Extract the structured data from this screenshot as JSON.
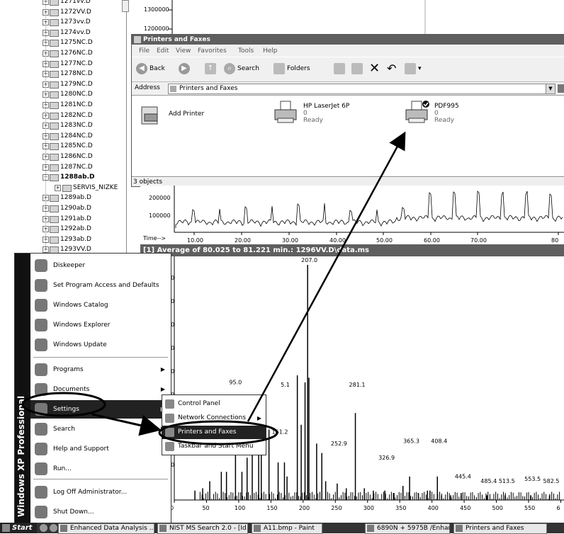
{
  "tree": {
    "items": [
      {
        "label": "1271vv.D"
      },
      {
        "label": "1272VV.D"
      },
      {
        "label": "1273vv.D"
      },
      {
        "label": "1274vv.D"
      },
      {
        "label": "1275NC.D"
      },
      {
        "label": "1276NC.D"
      },
      {
        "label": "1277NC.D"
      },
      {
        "label": "1278NC.D"
      },
      {
        "label": "1279NC.D"
      },
      {
        "label": "1280NC.D"
      },
      {
        "label": "1281NC.D"
      },
      {
        "label": "1282NC.D"
      },
      {
        "label": "1283NC.D"
      },
      {
        "label": "1284NC.D"
      },
      {
        "label": "1285NC.D"
      },
      {
        "label": "1286NC.D"
      },
      {
        "label": "1287NC.D"
      },
      {
        "label": "1288ab.D"
      },
      {
        "label": "SERVIS_NIZKE"
      },
      {
        "label": "1289ab.D"
      },
      {
        "label": "1290ab.D"
      },
      {
        "label": "1291ab.D"
      },
      {
        "label": "1292ab.D"
      },
      {
        "label": "1293ab.D"
      },
      {
        "label": "1293VV.D"
      }
    ]
  },
  "top_chart": {
    "ticks": [
      "1300000",
      "1200000"
    ]
  },
  "printers_window": {
    "title": "Printers and Faxes",
    "menu": [
      "File",
      "Edit",
      "View",
      "Favorites",
      "Tools",
      "Help"
    ],
    "toolbar": {
      "back": "Back",
      "search": "Search",
      "folders": "Folders"
    },
    "address_label": "Address",
    "address_value": "Printers and Faxes",
    "printers": [
      {
        "name": "Add Printer",
        "count": "",
        "status": ""
      },
      {
        "name": "HP LaserJet 6P",
        "count": "0",
        "status": "Ready"
      },
      {
        "name": "PDF995",
        "count": "0",
        "status": "Ready"
      }
    ],
    "status": "3 objects"
  },
  "mid_chart": {
    "ticks_y": [
      "200000",
      "100000"
    ],
    "time_label": "Time-->",
    "ticks_x": [
      "10.00",
      "20.00",
      "30.00",
      "40.00",
      "50.00",
      "60.00",
      "70.00",
      "80"
    ]
  },
  "spectrum": {
    "title": "[1] Average of 80.025 to 81.221 min.: 1296VV.D\\data.ms",
    "abundance_label": "nce",
    "y_ticks": [
      "000",
      "000",
      "000",
      "000",
      "000",
      "000",
      "000",
      "000",
      "000"
    ],
    "peak_labels": [
      "207.0",
      "95.0",
      "5.1",
      "161.2",
      "252.9",
      "281.1",
      "326.9",
      "365.3",
      "408.4",
      "445.4",
      "485.4",
      "513.5",
      "553.5",
      "582.5"
    ],
    "x_ticks": [
      "0",
      "50",
      "100",
      "150",
      "200",
      "250",
      "300",
      "350",
      "400",
      "450",
      "500",
      "550",
      "6"
    ]
  },
  "chart_data": {
    "type": "bar",
    "title": "Average of 80.025 to 81.221 min.: 1296VV.D\\data.ms",
    "xlabel": "",
    "ylabel": "",
    "xlim": [
      0,
      605
    ],
    "ylim": [
      0,
      1
    ],
    "x": [
      32,
      44,
      55,
      73,
      81,
      95,
      105,
      113,
      121,
      131,
      135,
      147,
      161.2,
      171,
      175,
      191,
      197,
      203,
      207,
      209,
      221,
      229,
      235,
      252.9,
      267,
      281.1,
      295,
      309,
      326.9,
      341,
      355,
      365.3,
      379,
      393,
      397,
      408.4,
      415,
      429,
      445.4,
      485.4,
      513.5,
      553.5,
      582.5
    ],
    "values": [
      0.04,
      0.05,
      0.08,
      0.12,
      0.12,
      0.42,
      0.12,
      0.18,
      0.22,
      0.2,
      0.36,
      0.3,
      0.16,
      0.16,
      0.1,
      0.53,
      0.32,
      0.5,
      1.0,
      0.52,
      0.24,
      0.2,
      0.08,
      0.07,
      0.05,
      0.37,
      0.05,
      0.04,
      0.04,
      0.03,
      0.06,
      0.1,
      0.03,
      0.04,
      0.04,
      0.1,
      0.02,
      0.02,
      0.03,
      0.02,
      0.02,
      0.02,
      0.02
    ]
  },
  "start_menu": {
    "brand": "Windows XP Professional",
    "items": [
      {
        "label": "Diskeeper",
        "arrow": ""
      },
      {
        "label": "Set Program Access and Defaults",
        "arrow": ""
      },
      {
        "label": "Windows Catalog",
        "arrow": ""
      },
      {
        "label": "Windows Explorer",
        "arrow": ""
      },
      {
        "label": "Windows Update",
        "arrow": ""
      },
      {
        "label": "Programs",
        "arrow": "▶"
      },
      {
        "label": "Documents",
        "arrow": "▶"
      },
      {
        "label": "Settings",
        "arrow": "▶"
      },
      {
        "label": "Search",
        "arrow": "▶"
      },
      {
        "label": "Help and Support",
        "arrow": ""
      },
      {
        "label": "Run...",
        "arrow": ""
      },
      {
        "label": "Log Off Administrator...",
        "arrow": ""
      },
      {
        "label": "Shut Down...",
        "arrow": ""
      }
    ]
  },
  "settings_submenu": {
    "items": [
      {
        "label": "Control Panel",
        "arrow": ""
      },
      {
        "label": "Network Connections",
        "arrow": "▶"
      },
      {
        "label": "Printers and Faxes",
        "arrow": ""
      },
      {
        "label": "Taskbar and Start Menu",
        "arrow": ""
      }
    ]
  },
  "taskbar": {
    "start": "Start",
    "tasks": [
      {
        "label": "Enhanced Data Analysis ..."
      },
      {
        "label": "NIST MS Search 2.0 - [Id..."
      },
      {
        "label": "A11.bmp - Paint"
      },
      {
        "label": "6890N + 5975B /Enhanc..."
      },
      {
        "label": "Printers and Faxes"
      }
    ]
  }
}
